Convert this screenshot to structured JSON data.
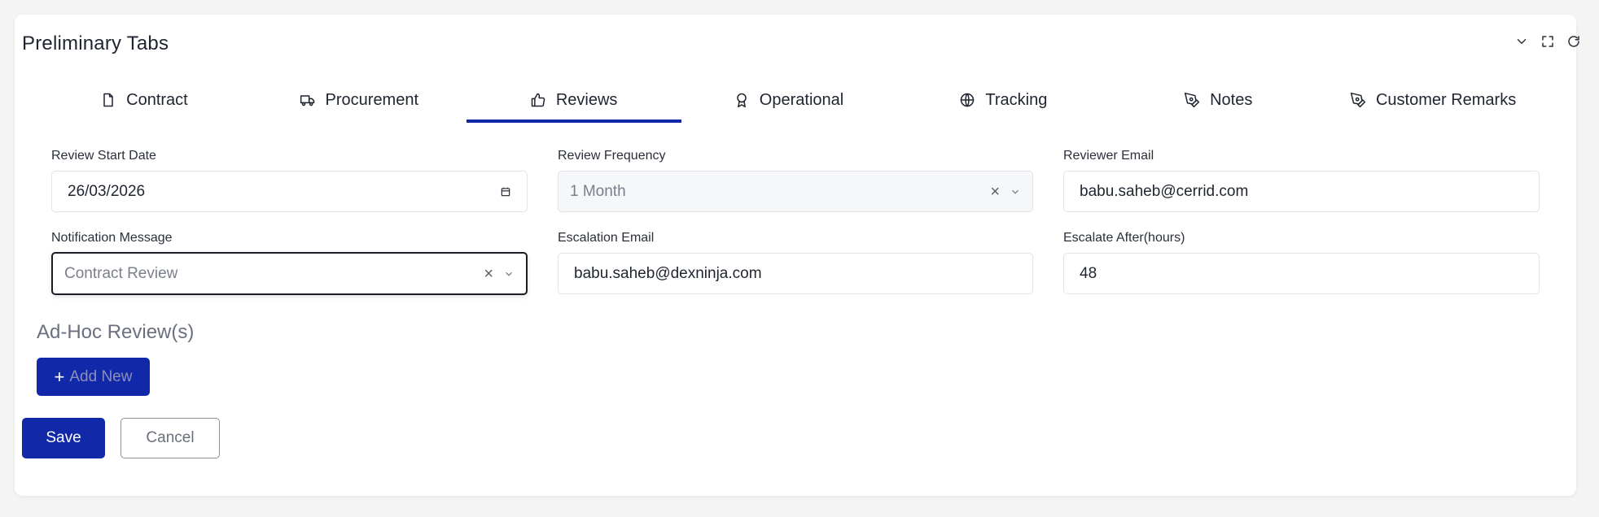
{
  "card": {
    "title": "Preliminary Tabs",
    "header_icons": [
      "chevron-down-icon",
      "fullscreen-icon",
      "refresh-icon"
    ]
  },
  "tabs": [
    {
      "label": "Contract",
      "icon": "file-icon",
      "active": false
    },
    {
      "label": "Procurement",
      "icon": "truck-icon",
      "active": false
    },
    {
      "label": "Reviews",
      "icon": "thumbs-up-icon",
      "active": true
    },
    {
      "label": "Operational",
      "icon": "award-icon",
      "active": false
    },
    {
      "label": "Tracking",
      "icon": "globe-icon",
      "active": false
    },
    {
      "label": "Notes",
      "icon": "pen-tool-icon",
      "active": false
    },
    {
      "label": "Customer Remarks",
      "icon": "pen-tool-icon",
      "active": false
    }
  ],
  "form": {
    "review_start_date": {
      "label": "Review Start Date",
      "value": "26/03/2026"
    },
    "review_frequency": {
      "label": "Review Frequency",
      "value": "1 Month"
    },
    "reviewer_email": {
      "label": "Reviewer Email",
      "value": "babu.saheb@cerrid.com"
    },
    "notification_message": {
      "label": "Notification Message",
      "value": "Contract Review"
    },
    "escalation_email": {
      "label": "Escalation Email",
      "value": "babu.saheb@dexninja.com"
    },
    "escalate_after": {
      "label": "Escalate After(hours)",
      "value": "48"
    }
  },
  "adhoc": {
    "title": "Ad-Hoc Review(s)",
    "add_plus": "+",
    "add_label": "Add New"
  },
  "actions": {
    "save_label": "Save",
    "cancel_label": "Cancel"
  },
  "colors": {
    "accent": "#1128a8",
    "muted_heading": "#6b6f80"
  }
}
